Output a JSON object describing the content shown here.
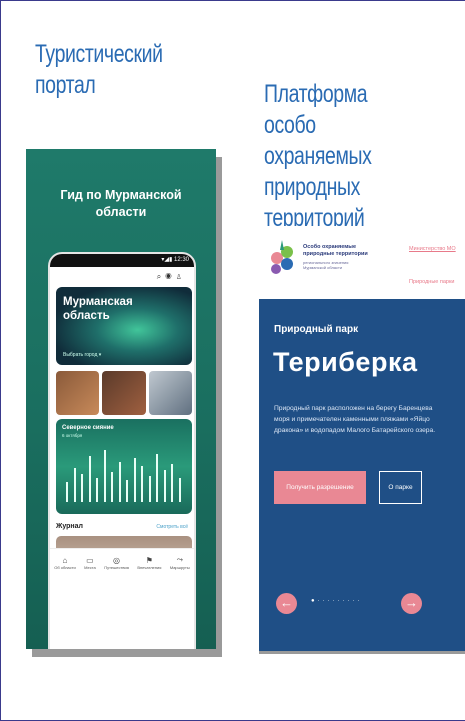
{
  "left_heading": [
    "Туристический",
    "портал"
  ],
  "right_heading": [
    "Платформа",
    "особо охраняемых",
    "природных территорий"
  ],
  "guide": {
    "title_line1": "Гид по Мурманской",
    "title_line2": "области",
    "status_time": "▾◢▮ 12:30",
    "hero_title_line1": "Мурманская",
    "hero_title_line2": "область",
    "hero_sub": "Выбрать город ▾",
    "aurora_title": "Северное сияние",
    "aurora_sub": "6 октября",
    "journal_label": "Журнал",
    "journal_link": "Смотреть всё",
    "tabs": [
      "Об области",
      "Места",
      "Путешествия",
      "Впечатления",
      "Маршруты"
    ]
  },
  "oopt": {
    "logo_line1": "Особо охраняемые",
    "logo_line2": "природные территории",
    "logo_sub1": "регионального значения",
    "logo_sub2": "Мурманской области",
    "nav_item1": "Министерство МО",
    "nav_item2": "Природные парки",
    "kicker": "Природный парк",
    "park_title": "Териберка",
    "desc_line1": "Природный парк расположен на берегу Баренцева",
    "desc_line2": "моря и примечателен каменными пляжами «Яйцо",
    "desc_line3": "дракона» и водопадом Малого Батарейского озера.",
    "btn_permit": "Получить разрешение",
    "btn_about": "О парке",
    "arrow_left": "←",
    "arrow_right": "→",
    "dots": "●·········"
  },
  "colors": {
    "heading": "#2a6bb3",
    "guide_bg": "#1f7a6a",
    "oopt_bg": "#1f4f86",
    "accent_pink": "#e98894"
  }
}
